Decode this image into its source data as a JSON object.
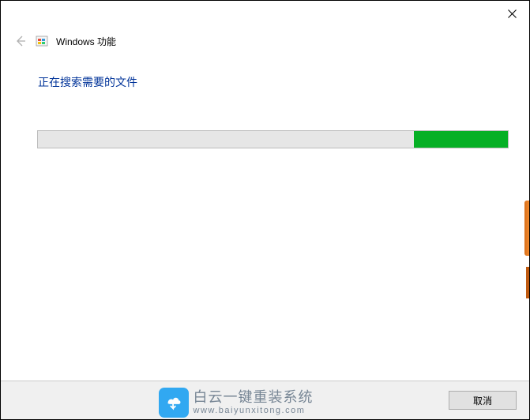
{
  "header": {
    "title": "Windows 功能"
  },
  "main": {
    "status_text": "正在搜索需要的文件",
    "progress_percent": 20
  },
  "footer": {
    "cancel_label": "取消"
  },
  "watermark": {
    "title": "白云一键重装系统",
    "url": "www.baiyunxitong.com"
  }
}
